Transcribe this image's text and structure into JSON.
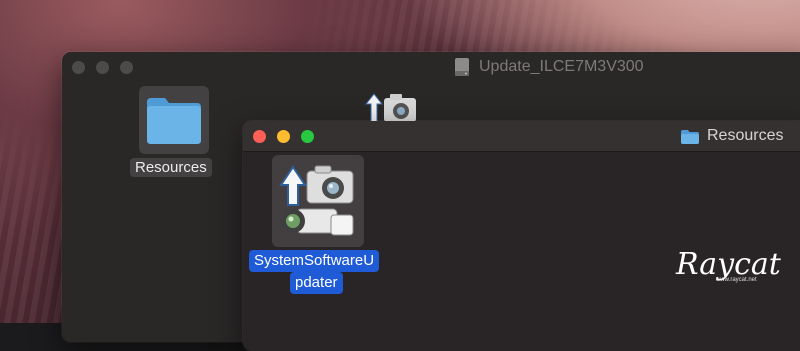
{
  "back_window": {
    "title": "Update_ILCE7M3V300",
    "folder_label": "Resources"
  },
  "front_window": {
    "title": "Resources",
    "app_label_line1": "SystemSoftwareU",
    "app_label_line2": "pdater"
  },
  "watermark": {
    "text": "Raycat",
    "url": "www.raycat.net"
  },
  "colors": {
    "selection": "#1f5bd6",
    "close": "#fe5f57",
    "minimize": "#febc2e",
    "zoom": "#28c840",
    "folder": "#6ab4e8"
  },
  "icons": [
    "hard-disk-icon",
    "folder-icon",
    "camera-update-icon"
  ]
}
